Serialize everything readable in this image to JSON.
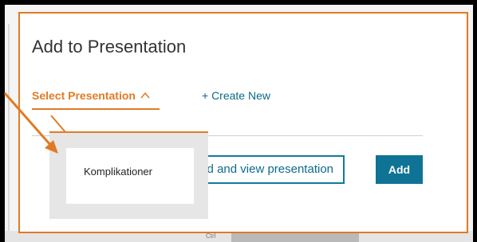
{
  "dialog": {
    "title": "Add to Presentation",
    "tabs": {
      "select_label": "Select Presentation",
      "create_label": "+ Create New"
    },
    "buttons": {
      "view_label": "dd and view presentation",
      "add_label": "Add"
    },
    "dropdown": {
      "items": [
        {
          "label": "Komplikationer"
        }
      ]
    }
  },
  "background": {
    "partial_label": "Ctrl"
  },
  "colors": {
    "accent": "#e07b24",
    "primary": "#0f7396",
    "link": "#0d6a8a"
  },
  "icons": {
    "chevron": "chevron-up-icon",
    "annotation": "arrow-icon"
  }
}
